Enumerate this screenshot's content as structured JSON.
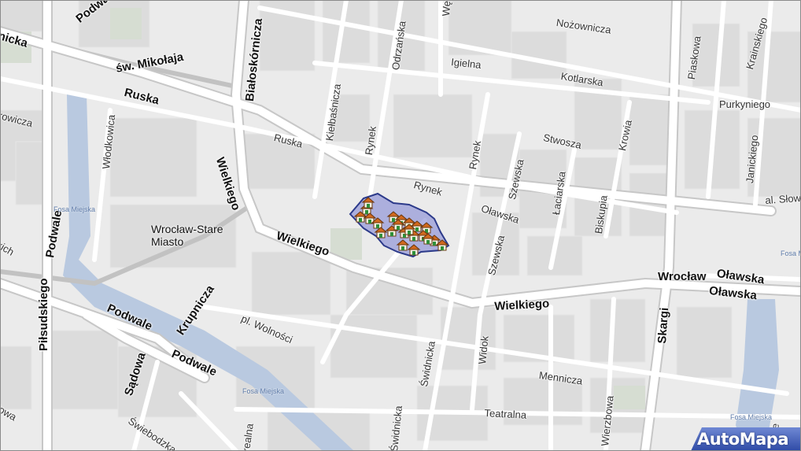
{
  "map": {
    "district_label": [
      "Wrocław-Stare",
      "Miasto"
    ],
    "streets": {
      "podwale_top": "Podwale",
      "nicka": "nicka",
      "sw_mikolaja": "św. Mikołaja",
      "ruska_w": "Ruska",
      "rowicza": "rowicza",
      "wlodkowica": "Włodkowica",
      "bialoskornicza": "Białoskórnicza",
      "odrzanska": "Odrzańska",
      "kielbasnicza": "Kiełbaśnicza",
      "weg": "Węg",
      "nozownicza": "Nożownicza",
      "igielna": "Igielna",
      "kotlarska": "Kotlarska",
      "plaskowa": "Piaskowa",
      "krainskiego": "Krainskiego",
      "purkyniego": "Purkyniego",
      "ruska_e": "Ruska",
      "rynek_v": "Rynek",
      "rynek_v2": "Rynek",
      "rynek_h": "Rynek",
      "stwosza": "Stwosza",
      "krowia": "Krowia",
      "janickiego": "Janickiego",
      "wielkiego_v": "Wielkiego",
      "szewska_1": "Szewska",
      "laciarska": "Łaciarska",
      "oławska": "Oławska",
      "bisknpia": "Biskupia",
      "sl_slow": "al. Słow",
      "wielkiego_1": "Wielkiego",
      "wielkiego_2": "Wielkiego",
      "kich": "kich",
      "podwale_v": "Podwale",
      "pilsudskiego": "Piłsudskiego",
      "krupnicza": "Krupnicza",
      "podwale_1": "Podwale",
      "podwale_2": "Podwale",
      "pl_wolnosci": "pl. Wolności",
      "szewska_2": "Szewska",
      "wroclaw": "Wrocław",
      "olawska_1": "Oławska",
      "olawska_2": "Oławska",
      "skargi": "Skargi",
      "swidnicka_1": "Świdnicka",
      "swidnicka_2": "Świdnicka",
      "widok": "Widok",
      "mennicza": "Mennicza",
      "sadowa": "Sądowa",
      "lowa": "łowa",
      "swiebodzka": "Świebodzka",
      "realna": "realna",
      "teatralna": "Teatralna",
      "wierzbowa": "Wierzbowa",
      "e": "e"
    },
    "water": {
      "fosa_1": "Fosa Miejska",
      "fosa_2": "Fosa Miejska",
      "fosa_3": "Fosa Miejska",
      "fosa_4": "Fosa Miejska"
    },
    "markers": {
      "icon": "house-marker-icon",
      "count": 22
    },
    "area_color": "#8b8fd6",
    "area_border_color": "#2c3a8a",
    "brand": "AutoMapa",
    "brand_color": "#3a56b0"
  }
}
